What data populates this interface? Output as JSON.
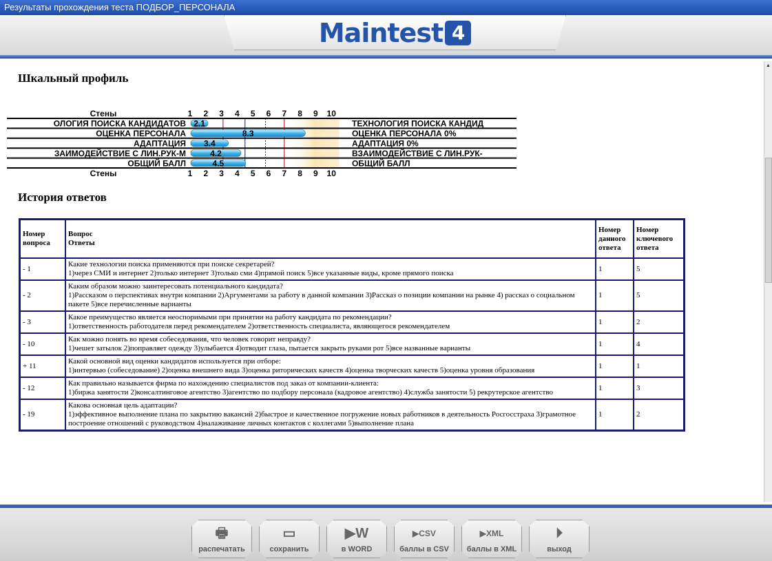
{
  "window": {
    "title": "Результаты прохождения теста ПОДБОР_ПЕРСОНАЛА"
  },
  "header": {
    "logo_text": "Maintest",
    "logo_badge": "4"
  },
  "profile": {
    "heading": "Шкальный профиль",
    "axis_label": "Стены",
    "ticks": [
      "1",
      "2",
      "3",
      "4",
      "5",
      "6",
      "7",
      "8",
      "9",
      "10"
    ],
    "rows": [
      {
        "left": "ОЛОГИЯ ПОИСКА КАНДИДАТОВ",
        "score": 2.1,
        "score_label": "2.1",
        "right": "ТЕХНОЛОГИЯ ПОИСКА КАНДИД"
      },
      {
        "left": "ОЦЕНКА ПЕРСОНАЛА",
        "score": 8.3,
        "score_label": "8.3",
        "right": "ОЦЕНКА ПЕРСОНАЛА  0%"
      },
      {
        "left": "АДАПТАЦИЯ",
        "score": 3.4,
        "score_label": "3.4",
        "right": "АДАПТАЦИЯ  0%"
      },
      {
        "left": "ЗАИМОДЕЙСТВИЕ С ЛИН.РУК-М",
        "score": 4.2,
        "score_label": "4.2",
        "right": "ВЗАИМОДЕЙСТВИЕ С ЛИН.РУК-"
      },
      {
        "left": "ОБЩИЙ БАЛЛ",
        "score": 4.5,
        "score_label": "4.5",
        "right": "ОБЩИЙ БАЛЛ"
      }
    ]
  },
  "history": {
    "heading": "История ответов",
    "columns": {
      "num_1": "Номер",
      "num_2": "вопроса",
      "q_1": "Вопрос",
      "q_2": "Ответы",
      "given_1": "Номер",
      "given_2": "данного",
      "given_3": "ответа",
      "key_1": "Номер",
      "key_2": "ключевого",
      "key_3": "ответа"
    },
    "rows": [
      {
        "num": "- 1",
        "question": "Какие технологии поиска применяются при поиске секретарей?",
        "answers": "1)через СМИ и интернет 2)только интернет 3)только сми 4)прямой поиск 5)все указанные виды, кроме прямого поиска",
        "given": "1",
        "key": "5"
      },
      {
        "num": "- 2",
        "question": "Каким образом можно заинтересовать потенциального кандидата?",
        "answers": "1)Рассказом о перспективах внутри компании 2)Аргументами за работу в данной компании 3)Рассказ о позиции компании на рынке 4) рассказ о социальном пакете 5)все перечисленные варианты",
        "given": "1",
        "key": "5"
      },
      {
        "num": "- 3",
        "question": "Какое преимущество является неоспоримыми при принятии на работу кандидата по рекомендации?",
        "answers": "1)ответственность работодателя перед рекомендателем 2)ответственность специалиста, являющегося рекомендателем",
        "given": "1",
        "key": "2"
      },
      {
        "num": "- 10",
        "question": "Как можно понять во время собеседования, что человек говорит неправду?",
        "answers": "1)чешет затылок 2)поправляет одежду 3)улыбается 4)отводит глаза, пытается закрыть руками рот 5)все названные варианты",
        "given": "1",
        "key": "4"
      },
      {
        "num": "+ 11",
        "question": "Какой основной вид оценки кандидатов используется при отборе:",
        "answers": "1)интервью (собеседование) 2)оценка внешнего вида 3)оценка риторических качеств 4)оценка творческих качеств 5)оценка уровня образования",
        "given": "1",
        "key": "1"
      },
      {
        "num": "- 12",
        "question": "Как правильно называется фирма по нахождению специалистов под заказ от компании-клиента:",
        "answers": "1)биржа занятости 2)консалтинговое агентство 3)агентство по подбору персонала (кадровое агентство) 4)служба занятости 5) рекрутерское агентство",
        "given": "1",
        "key": "3"
      },
      {
        "num": "- 19",
        "question": "Какова основная цель адаптации?",
        "answers": "1)эффективное выполнение плана по закрытию вакансий 2)быстрое и качественное погружение новых работников в деятельность Росгосстраха 3)грамотное построение отношений с руководством 4)налаживание личных контактов с коллегами 5)выполнение плана",
        "given": "1",
        "key": "2"
      }
    ]
  },
  "toolbar": {
    "print": "распечатать",
    "save": "сохранить",
    "word": "в WORD",
    "csv": "баллы в CSV",
    "xml": "баллы в XML",
    "exit": "выход",
    "csv_tag": "CSV",
    "xml_tag": "XML"
  }
}
